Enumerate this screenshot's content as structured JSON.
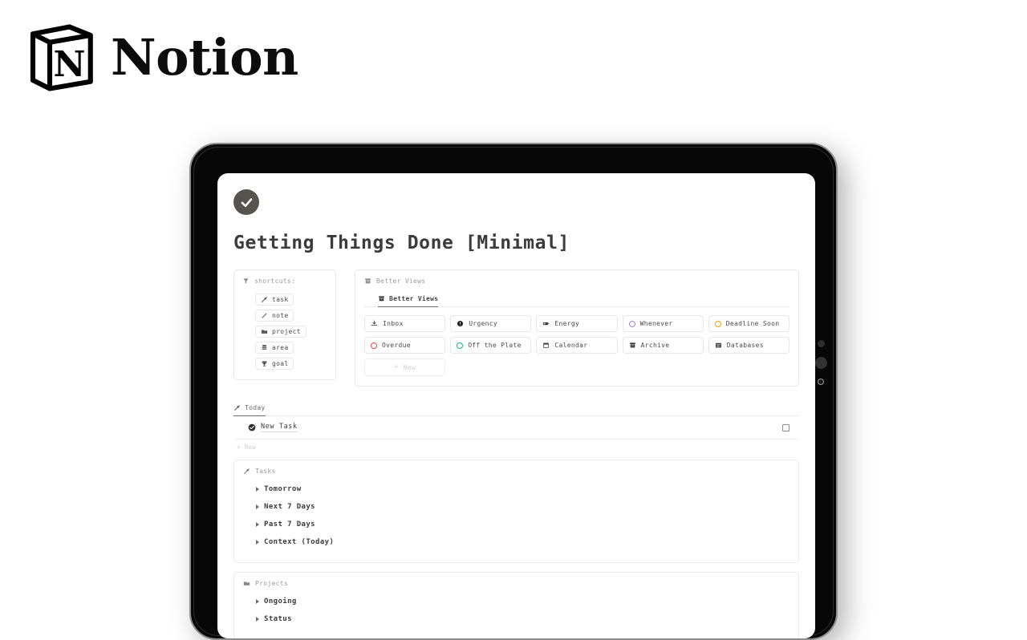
{
  "brand": {
    "name": "Notion",
    "logo_icon": "notion-cube-logo"
  },
  "page": {
    "icon": "check-circle-icon",
    "title": "Getting Things Done [Minimal]"
  },
  "shortcuts": {
    "icon": "funnel-icon",
    "heading": "shortcuts:",
    "items": [
      {
        "label": "task",
        "icon": "pen-check-icon"
      },
      {
        "label": "note",
        "icon": "pencil-icon"
      },
      {
        "label": "project",
        "icon": "folder-icon"
      },
      {
        "label": "area",
        "icon": "stack-icon"
      },
      {
        "label": "goal",
        "icon": "trophy-icon"
      }
    ]
  },
  "better_views": {
    "icon": "archive-icon",
    "heading": "Better Views",
    "tab": {
      "label": "Better Views",
      "icon": "archive-icon",
      "active": true
    },
    "buttons": [
      {
        "label": "Inbox",
        "icon": "inbox-tray-icon",
        "color": "#4a4a4a"
      },
      {
        "label": "Urgency",
        "icon": "exclamation-circle-icon",
        "color": "#1f1f1f"
      },
      {
        "label": "Energy",
        "icon": "battery-icon",
        "color": "#3a3a3a"
      },
      {
        "label": "Whenever",
        "icon": "ring-icon",
        "color": "#9b7fd4"
      },
      {
        "label": "Deadline Soon",
        "icon": "ring-icon",
        "color": "#f59e0b"
      },
      {
        "label": "Overdue",
        "icon": "ring-icon",
        "color": "#ef4444"
      },
      {
        "label": "Off the Plate",
        "icon": "ring-icon",
        "color": "#10b981"
      },
      {
        "label": "Calendar",
        "icon": "calendar-icon",
        "color": "#3a3a3a"
      },
      {
        "label": "Archive",
        "icon": "archive-icon",
        "color": "#3a3a3a"
      },
      {
        "label": "Databases",
        "icon": "table-grid-icon",
        "color": "#3a3a3a"
      }
    ],
    "new_button": {
      "label": "New",
      "plus": "+"
    }
  },
  "today": {
    "tab": {
      "label": "Today",
      "icon": "pen-check-icon"
    },
    "task": {
      "name": "New Task",
      "icon": "check-circle-icon",
      "checkbox_checked": false
    },
    "new_row": {
      "plus": "+",
      "label": "New"
    }
  },
  "tasks_section": {
    "icon": "pen-check-icon",
    "heading": "Tasks",
    "toggles": [
      {
        "label": "Tomorrow"
      },
      {
        "label": "Next 7 Days"
      },
      {
        "label": "Past 7 Days"
      },
      {
        "label": "Context (Today)"
      }
    ]
  },
  "projects_section": {
    "icon": "folder-icon",
    "heading": "Projects",
    "toggles": [
      {
        "label": "Ongoing"
      },
      {
        "label": "Status"
      }
    ]
  },
  "colors": {
    "page_icon_bg": "#57534e",
    "title": "#3b3b3b",
    "muted": "#9a9a9a",
    "border": "#e7e7e7",
    "purple": "#9b7fd4",
    "orange": "#f59e0b",
    "red": "#ef4444",
    "green": "#10b981"
  }
}
